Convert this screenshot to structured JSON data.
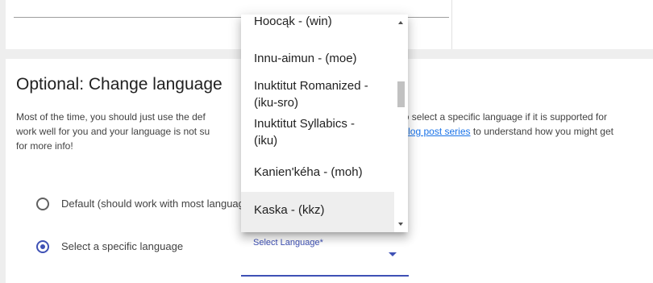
{
  "section": {
    "title": "Optional: Change language",
    "para_line1_a": "Most of the time, you should just use the def",
    "para_line1_b": "o select a specific language if it is supported for",
    "para_line2_a": "work well for you and your language is not su",
    "para_line2_link": "log post series",
    "para_line2_b": " to understand how you might get",
    "para_line3": "for more info!"
  },
  "radios": [
    {
      "label": "Default (should work with most languages)",
      "selected": false
    },
    {
      "label": "Select a specific language",
      "selected": true
    }
  ],
  "select": {
    "label": "Select Language*",
    "accent": "#3f51b5"
  },
  "dropdown": {
    "options": [
      {
        "lines": [
          "Hoocąk - (win)"
        ]
      },
      {
        "lines": [
          "Innu-aimun - (moe)"
        ]
      },
      {
        "lines": [
          "Inuktitut Romanized -",
          "(iku-sro)"
        ]
      },
      {
        "lines": [
          "Inuktitut Syllabics -",
          "(iku)"
        ]
      },
      {
        "lines": [
          "Kanien'kéha - (moh)"
        ]
      },
      {
        "lines": [
          "Kaska - (kkz)"
        ]
      }
    ]
  }
}
